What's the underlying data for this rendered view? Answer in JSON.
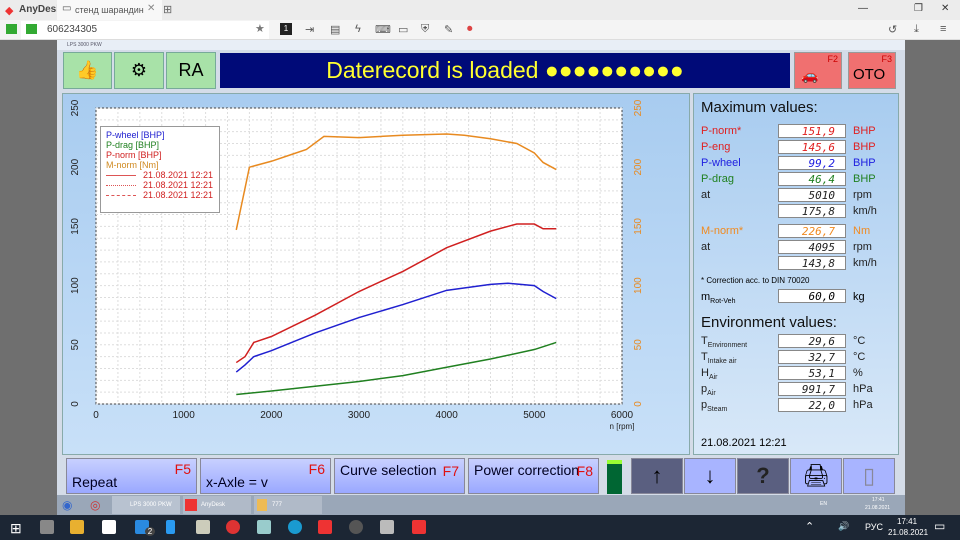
{
  "anydesk": {
    "brand": "AnyDesk",
    "tab_label": "стенд шарандин",
    "address": "606234305",
    "monitor_badge": "1"
  },
  "app": {
    "title": "LPS 3000 PKW",
    "button_ra": "RA",
    "banner": "Daterecord is loaded ●●●●●●●●●●",
    "f2": "F2",
    "f3": "F3"
  },
  "chart_data": {
    "type": "line",
    "xlabel": "n [rpm]",
    "xlim": [
      0,
      6000
    ],
    "ylim": [
      0,
      250
    ],
    "y2lim": [
      0,
      250
    ],
    "xticks": [
      0,
      1000,
      2000,
      3000,
      4000,
      5000,
      6000
    ],
    "yticks": [
      0,
      50,
      100,
      150,
      200,
      250
    ],
    "legend": [
      "P-wheel [BHP]",
      "P-drag [BHP]",
      "P-norm [BHP]",
      "M-norm [Nm]"
    ],
    "legend_dates": [
      "21.08.2021 12:21",
      "21.08.2021 12:21",
      "21.08.2021 12:21"
    ],
    "series": [
      {
        "name": "P-wheel [BHP]",
        "color": "#2020d0",
        "x": [
          1600,
          1700,
          1800,
          2000,
          2500,
          3000,
          3500,
          4000,
          4500,
          4700,
          5000,
          5100,
          5250
        ],
        "y": [
          27,
          33,
          40,
          45,
          60,
          73,
          84,
          96,
          101,
          102,
          100,
          95,
          89
        ]
      },
      {
        "name": "P-drag [BHP]",
        "color": "#208020",
        "x": [
          1600,
          2000,
          2500,
          3000,
          3500,
          4000,
          4500,
          5000,
          5250
        ],
        "y": [
          8,
          11,
          15,
          19,
          24,
          31,
          38,
          46,
          52
        ]
      },
      {
        "name": "P-norm [BHP]",
        "color": "#d02020",
        "x": [
          1600,
          1700,
          1800,
          2000,
          2500,
          3000,
          3500,
          4000,
          4500,
          4800,
          5000,
          5100,
          5250
        ],
        "y": [
          35,
          40,
          52,
          57,
          75,
          95,
          112,
          132,
          146,
          152,
          152,
          148,
          148
        ]
      },
      {
        "name": "M-norm [Nm]",
        "color": "#e88a20",
        "x": [
          1600,
          1750,
          1800,
          2000,
          2200,
          2400,
          2600,
          3000,
          3500,
          4000,
          4200,
          4500,
          4800,
          5000,
          5100,
          5250
        ],
        "y": [
          147,
          200,
          201,
          205,
          210,
          215,
          226,
          225,
          227,
          228,
          227,
          224,
          220,
          212,
          204,
          198
        ]
      }
    ]
  },
  "max": {
    "title": "Maximum values:",
    "rows": [
      {
        "label": "P-norm*",
        "value": "151,9",
        "unit": "BHP",
        "color": "#e02020"
      },
      {
        "label": "P-eng",
        "value": "145,6",
        "unit": "BHP",
        "color": "#e02020"
      },
      {
        "label": "P-wheel",
        "value": "99,2",
        "unit": "BHP",
        "color": "#2020e0"
      },
      {
        "label": "P-drag",
        "value": "46,4",
        "unit": "BHP",
        "color": "#208020"
      },
      {
        "label": "at",
        "value": "5010",
        "unit": "rpm",
        "color": "#222"
      },
      {
        "label": "",
        "value": "175,8",
        "unit": "km/h",
        "color": "#222"
      },
      {
        "label": "M-norm*",
        "value": "226,7",
        "unit": "Nm",
        "color": "#f08a20"
      },
      {
        "label": "at",
        "value": "4095",
        "unit": "rpm",
        "color": "#222"
      },
      {
        "label": "",
        "value": "143,8",
        "unit": "km/h",
        "color": "#222"
      }
    ],
    "note": "* Correction acc. to DIN 70020",
    "mrot": {
      "label": "m",
      "sub": "Rot-Veh",
      "value": "60,0",
      "unit": "kg"
    }
  },
  "env": {
    "title": "Environment values:",
    "rows": [
      {
        "label": "T",
        "sub": "Environment",
        "value": "29,6",
        "unit": "°C"
      },
      {
        "label": "T",
        "sub": "Intake air",
        "value": "32,7",
        "unit": "°C"
      },
      {
        "label": "H",
        "sub": "Air",
        "value": "53,1",
        "unit": "%"
      },
      {
        "label": "p",
        "sub": "Air",
        "value": "991,7",
        "unit": "hPa"
      },
      {
        "label": "p",
        "sub": "Steam",
        "value": "22,0",
        "unit": "hPa"
      }
    ],
    "datetime": "21.08.2021   12:21"
  },
  "bottom": [
    {
      "label": "Repeat",
      "key": "F5"
    },
    {
      "label": "x-Axle = v",
      "key": "F6"
    },
    {
      "label": "Curve selection",
      "key": "F7"
    },
    {
      "label": "Power correction",
      "key": "F8"
    }
  ],
  "remote_taskbar": {
    "items": [
      "LPS 3000 PKW",
      "AnyDesk",
      "777"
    ],
    "lang": "EN",
    "time": "17:41",
    "date": "21.08.2021"
  },
  "taskbar": {
    "lang": "РУС",
    "time": "17:41",
    "date": "21.08.2021",
    "mail_badge": "2"
  }
}
